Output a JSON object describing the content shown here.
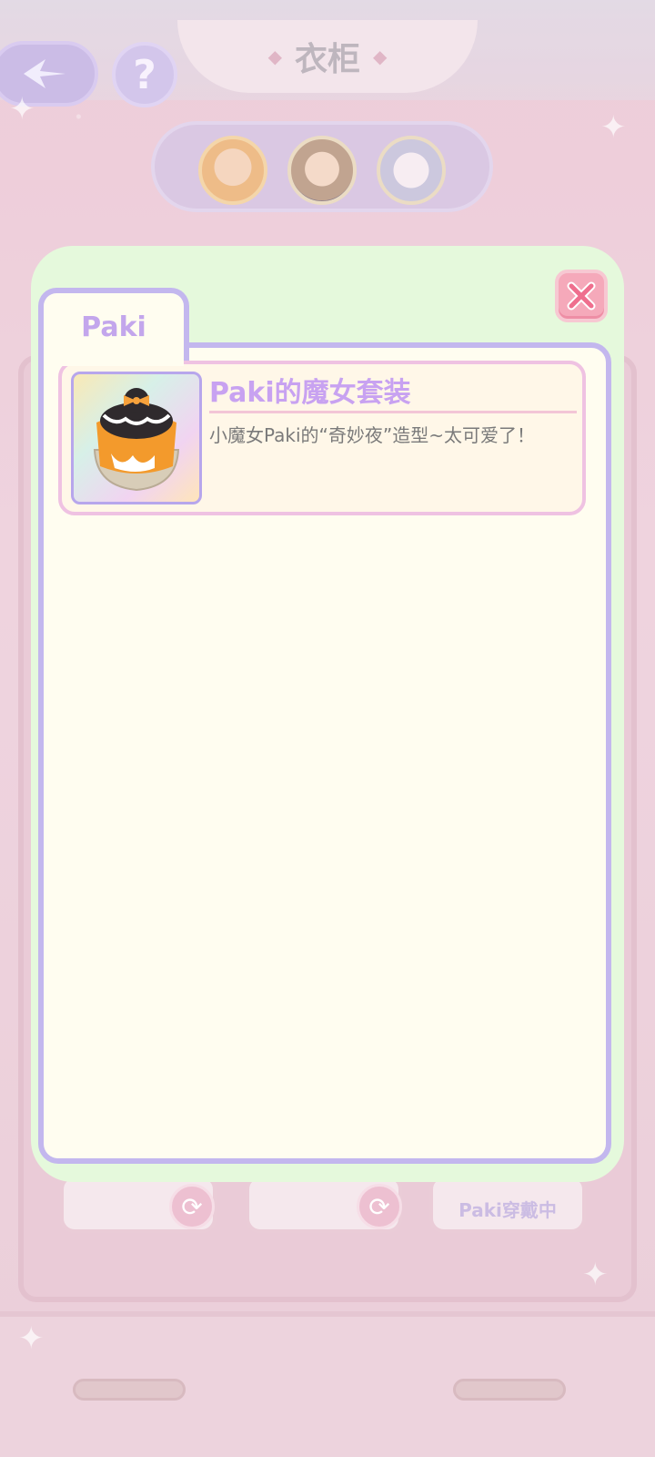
{
  "screen": {
    "title": "衣柜",
    "back_icon": "back-arrow-icon",
    "help_label": "?"
  },
  "characters": [
    {
      "name": "paki-avatar"
    },
    {
      "name": "character-2-avatar"
    },
    {
      "name": "character-3-avatar"
    }
  ],
  "wardrobe": {
    "slot_status": "Paki穿戴中"
  },
  "dialog": {
    "tab_label": "Paki",
    "close_icon": "close-icon",
    "items": [
      {
        "name": "Paki的魔女套装",
        "description": "小魔女Paki的“奇妙夜”造型~太可爱了！"
      }
    ]
  },
  "colors": {
    "dialog_bg": "#e5f9dc",
    "panel_bg": "#fffdf0",
    "panel_border": "#c3b7ee",
    "item_title": "#c8a2f1",
    "close_button": "#f5a9ba"
  }
}
